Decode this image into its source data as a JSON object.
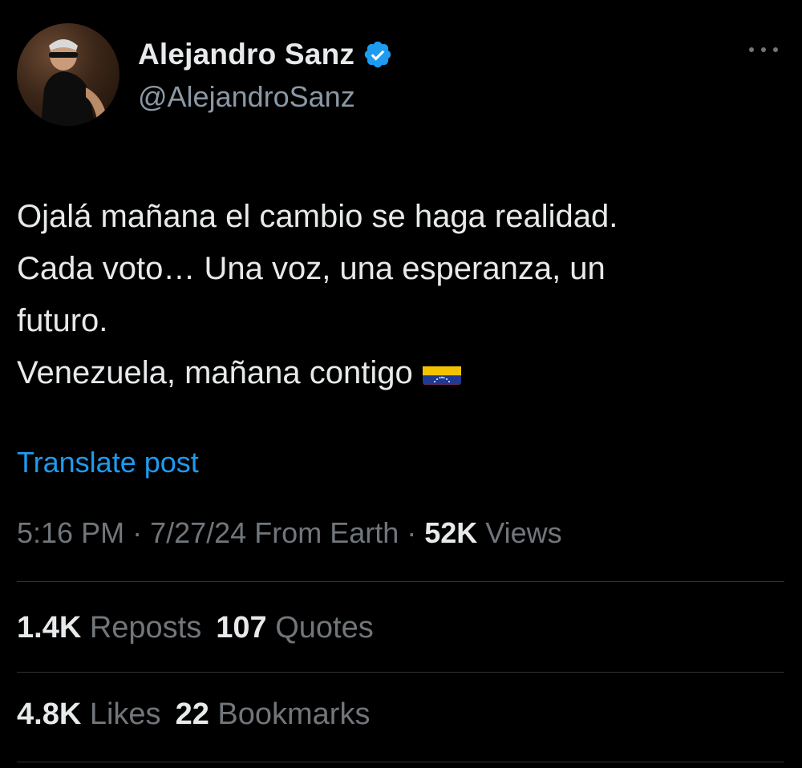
{
  "author": {
    "name": "Alejandro Sanz",
    "handle": "@AlejandroSanz",
    "verified": true
  },
  "tweet": {
    "lines": [
      "Ojalá mañana el cambio se haga realidad.",
      "Cada voto… Una voz, una esperanza, un",
      "futuro.",
      "Venezuela, mañana contigo"
    ],
    "flag_icon": "venezuela-flag-icon"
  },
  "translate_label": "Translate post",
  "meta": {
    "time": "5:16 PM",
    "sep1": " · ",
    "date": "7/27/24",
    "source": " From Earth",
    "sep2": " · ",
    "views_count": "52K",
    "views_label": " Views"
  },
  "stats": {
    "reposts_count": "1.4K",
    "reposts_label": " Reposts",
    "quotes_count": "107",
    "quotes_label": " Quotes",
    "likes_count": "4.8K",
    "likes_label": " Likes",
    "bookmarks_count": "22",
    "bookmarks_label": " Bookmarks"
  },
  "colors": {
    "background": "#000000",
    "text_primary": "#e7e9ea",
    "text_secondary": "#71767b",
    "accent": "#1d9bf0",
    "divider": "#2f3336"
  }
}
